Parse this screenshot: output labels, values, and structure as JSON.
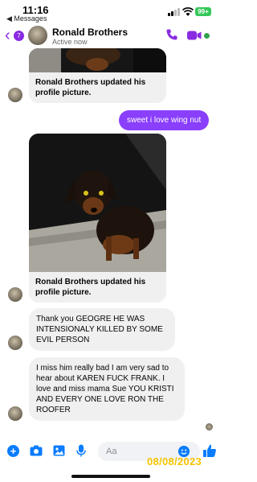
{
  "status_bar": {
    "time": "11:16",
    "back_app": "◀ Messages",
    "battery": "99+"
  },
  "header": {
    "back_badge": "7",
    "contact_name": "Ronald Brothers",
    "contact_status": "Active now"
  },
  "messages": [
    {
      "type": "photo_update",
      "caption": "Ronald Brothers updated his profile picture."
    },
    {
      "type": "outgoing",
      "text": "sweet   i love wing nut"
    },
    {
      "type": "photo_update",
      "caption": "Ronald Brothers updated his profile picture."
    },
    {
      "type": "incoming",
      "text": "Thank you GEOGRE HE WAS INTENSIONALY KILLED BY SOME EVIL PERSON"
    },
    {
      "type": "incoming",
      "text": "I miss him really bad I am very sad to hear about KAREN  FUCK FRANK. I love and miss mama Sue YOU KRISTI AND EVERY ONE  LOVE RON THE ROOFER"
    }
  ],
  "composer": {
    "placeholder": "Aa"
  },
  "date_stamp": "08/08/2023",
  "colors": {
    "accent": "#8a2be2",
    "outgoing_bubble": "#8a3ffc",
    "incoming_bubble": "#f0f0f0",
    "composer_icons": "#0a7cff",
    "date_stamp": "#f5c400"
  }
}
